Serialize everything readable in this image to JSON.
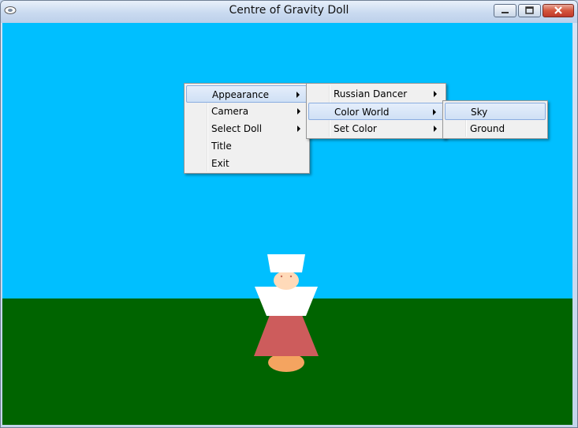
{
  "window": {
    "title": "Centre of Gravity Doll"
  },
  "colors": {
    "sky": "#00bfff",
    "ground": "#006400",
    "skirt": "#cd5c5c",
    "face": "#ffdab9",
    "feet": "#f4a460",
    "menu_highlight": "#cfe0f5"
  },
  "context_menu": {
    "items": [
      {
        "label": "Appearance",
        "has_submenu": true,
        "highlighted": true
      },
      {
        "label": "Camera",
        "has_submenu": true
      },
      {
        "label": "Select Doll",
        "has_submenu": true
      },
      {
        "label": "Title",
        "has_submenu": false
      },
      {
        "label": "Exit",
        "has_submenu": false
      }
    ]
  },
  "appearance_submenu": {
    "items": [
      {
        "label": "Russian Dancer",
        "has_submenu": true
      },
      {
        "label": "Color World",
        "has_submenu": true,
        "highlighted": true
      },
      {
        "label": "Set Color",
        "has_submenu": true
      }
    ]
  },
  "color_world_submenu": {
    "items": [
      {
        "label": "Sky",
        "highlighted": true
      },
      {
        "label": "Ground"
      }
    ]
  },
  "icons": {
    "app": "app-icon",
    "minimize": "minimize-icon",
    "maximize": "maximize-icon",
    "close": "close-icon",
    "submenu_arrow": "chevron-right-icon"
  }
}
